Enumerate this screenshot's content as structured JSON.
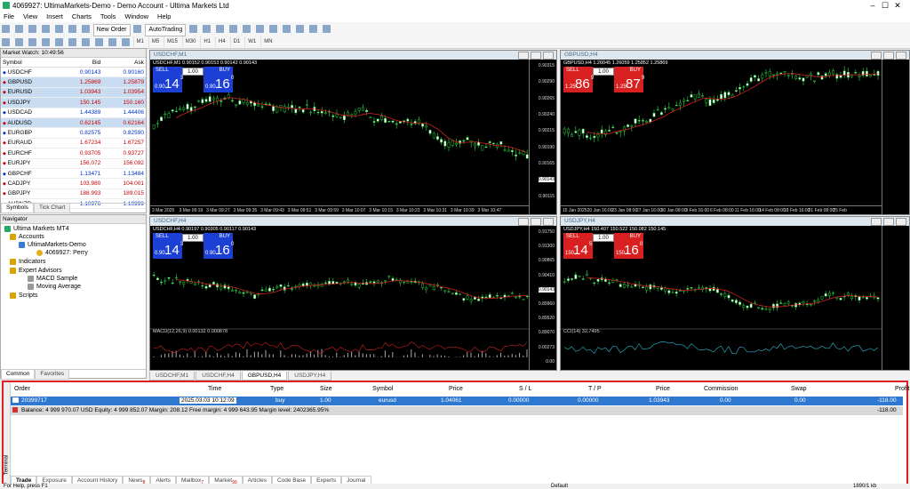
{
  "window": {
    "title": "4069927: UltimaMarkets-Demo - Demo Account - Ultima Markets Ltd",
    "minimize": "–",
    "maximize": "☐",
    "close": "✕"
  },
  "menu": [
    "File",
    "View",
    "Insert",
    "Charts",
    "Tools",
    "Window",
    "Help"
  ],
  "toolbar": {
    "new_order": "New Order",
    "autotrading": "AutoTrading",
    "timeframes": [
      "M1",
      "M5",
      "M15",
      "M30",
      "H1",
      "H4",
      "D1",
      "W1",
      "MN"
    ]
  },
  "market_watch": {
    "title": "Market Watch: 10:49:56",
    "columns": [
      "Symbol",
      "Bid",
      "Ask"
    ],
    "rows": [
      {
        "symbol": "USDCHF",
        "bid": "0.90143",
        "ask": "0.90160",
        "dir": "up",
        "sel": false
      },
      {
        "symbol": "GBPUSD",
        "bid": "1.25869",
        "ask": "1.25879",
        "dir": "dn",
        "sel": true
      },
      {
        "symbol": "EURUSD",
        "bid": "1.03943",
        "ask": "1.03954",
        "dir": "dn",
        "sel": true
      },
      {
        "symbol": "USDJPY",
        "bid": "150.145",
        "ask": "150.160",
        "dir": "dn",
        "sel": true
      },
      {
        "symbol": "USDCAD",
        "bid": "1.44389",
        "ask": "1.44406",
        "dir": "up",
        "sel": false
      },
      {
        "symbol": "AUDUSD",
        "bid": "0.62145",
        "ask": "0.62164",
        "dir": "dn",
        "sel": true
      },
      {
        "symbol": "EURGBP",
        "bid": "0.82575",
        "ask": "0.82590",
        "dir": "up",
        "sel": false
      },
      {
        "symbol": "EURAUD",
        "bid": "1.67234",
        "ask": "1.67257",
        "dir": "dn",
        "sel": false
      },
      {
        "symbol": "EURCHF",
        "bid": "0.93705",
        "ask": "0.93727",
        "dir": "dn",
        "sel": false
      },
      {
        "symbol": "EURJPY",
        "bid": "156.072",
        "ask": "156.092",
        "dir": "dn",
        "sel": false
      },
      {
        "symbol": "GBPCHF",
        "bid": "1.13471",
        "ask": "1.13484",
        "dir": "up",
        "sel": false
      },
      {
        "symbol": "CADJPY",
        "bid": "103.980",
        "ask": "104.001",
        "dir": "dn",
        "sel": false
      },
      {
        "symbol": "GBPJPY",
        "bid": "188.993",
        "ask": "189.015",
        "dir": "dn",
        "sel": false
      },
      {
        "symbol": "AUDNZD",
        "bid": "1.10976",
        "ask": "1.10999",
        "dir": "up",
        "sel": false
      }
    ],
    "tabs": [
      "Symbols",
      "Tick Chart"
    ]
  },
  "navigator": {
    "title": "Navigator",
    "items": [
      "Ultima Markets MT4",
      "Accounts",
      "UltimaMarkets-Demo",
      "4069927: Perry",
      "Indicators",
      "Expert Advisors",
      "MACD Sample",
      "Moving Average",
      "Scripts"
    ],
    "tabs": [
      "Common",
      "Favorites"
    ]
  },
  "charts": [
    {
      "title": "USDCHF,M1",
      "info": "USDCHF,M1 0.90152 0.90153 0.90142 0.90143",
      "sell_small": "0.90",
      "sell_big": "14",
      "sell_sup": "3",
      "buy_small": "0.90",
      "buy_big": "16",
      "buy_sup": "0",
      "lot": "1.00",
      "color": "blue",
      "prices": [
        "0.90315",
        "0.90290",
        "0.90265",
        "0.90240",
        "0.90215",
        "0.90190",
        "0.90165",
        "0.90143",
        "0.90115"
      ],
      "times": [
        "3 Mar 2025",
        "3 Mar 09:19",
        "3 Mar 09:27",
        "3 Mar 09:35",
        "3 Mar 09:43",
        "3 Mar 09:51",
        "3 Mar 09:59",
        "3 Mar 10:07",
        "3 Mar 10:15",
        "3 Mar 10:23",
        "3 Mar 10:31",
        "3 Mar 10:39",
        "3 Mar 10:47"
      ]
    },
    {
      "title": "GBPUSD,H4",
      "info": "GBPUSD,H4 1.26045 1.26059 1.25852 1.25869",
      "sell_small": "1.25",
      "sell_big": "86",
      "sell_sup": "9",
      "buy_small": "1.25",
      "buy_big": "87",
      "buy_sup": "9",
      "lot": "1.00",
      "color": "red",
      "prices": [],
      "times": [
        "15 Jan 2025",
        "20 Jan 16:00",
        "23 Jan 08:00",
        "27 Jan 16:00",
        "30 Jan 08:00",
        "3 Feb 16:00",
        "6 Feb 08:00",
        "11 Feb 16:00",
        "14 Feb 08:00",
        "18 Feb 16:00",
        "21 Feb 08:00",
        "25 Feb"
      ]
    },
    {
      "title": "USDCHF,H4",
      "info": "USDCHF,H4 0.90197 0.90305 0.90117 0.90143",
      "sell_small": "0.90",
      "sell_big": "14",
      "sell_sup": "3",
      "buy_small": "0.90",
      "buy_big": "16",
      "buy_sup": "0",
      "lot": "1.00",
      "color": "blue",
      "prices": [
        "0.91750",
        "0.91300",
        "0.90865",
        "0.90410",
        "0.90143",
        "0.89960",
        "0.89520",
        "0.89070",
        "0.00273",
        "0.00"
      ],
      "indicator": "MACD(12,26,9) 0.00132 0.000878"
    },
    {
      "title": "USDJPY,H4",
      "info": "USDJPY,H4 150.407 150.522 150.082 150.145",
      "sell_small": "150",
      "sell_big": "14",
      "sell_sup": "5",
      "buy_small": "150",
      "buy_big": "16",
      "buy_sup": "0",
      "lot": "1.00",
      "color": "red",
      "prices": [],
      "indicator": "CCI(14) 32.7495"
    }
  ],
  "chart_tabs": [
    "USDCHF,M1",
    "USDCHF,H4",
    "GBPUSD,H4",
    "USDJPY,H4"
  ],
  "terminal": {
    "columns": [
      "Order",
      "Time",
      "Type",
      "Size",
      "Symbol",
      "Price",
      "S / L",
      "T / P",
      "Price",
      "Commission",
      "Swap",
      "Profit"
    ],
    "trade": [
      "20399717",
      "2025.03.03 10:12:09",
      "buy",
      "1.00",
      "eurusd",
      "1.04061",
      "0.00000",
      "0.00000",
      "1.03943",
      "0.00",
      "0.00",
      "-118.00"
    ],
    "balance": "Balance: 4 999 970.07 USD  Equity: 4 999 852.07  Margin: 208.12  Free margin: 4 999 643.95  Margin level: 2402365.95%",
    "balance_profit": "-118.00",
    "side_label": "Terminal",
    "tabs": [
      "Trade",
      "Exposure",
      "Account History",
      "News",
      "Alerts",
      "Mailbox",
      "Market",
      "Articles",
      "Code Base",
      "Experts",
      "Journal"
    ],
    "tab_badges": {
      "News": "8",
      "Mailbox": "7",
      "Market": "99"
    }
  },
  "status": {
    "help": "For Help, press F1",
    "profile": "Default",
    "traffic": "1890/1 kb"
  }
}
